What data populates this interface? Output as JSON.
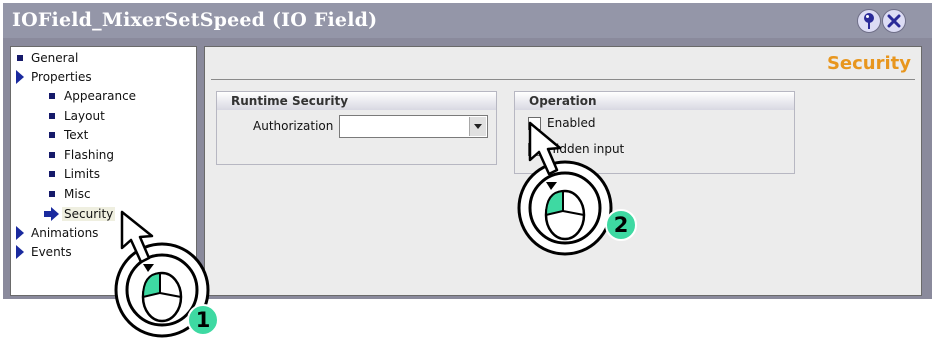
{
  "window": {
    "title": "IOField_MixerSetSpeed (IO Field)",
    "help_icon": "help-pin-icon",
    "close_icon": "close-icon"
  },
  "tree": {
    "items": [
      {
        "label": "General",
        "level": 0,
        "icon": "bullet"
      },
      {
        "label": "Properties",
        "level": 0,
        "icon": "expand-arrow"
      },
      {
        "label": "Appearance",
        "level": 1,
        "icon": "bullet"
      },
      {
        "label": "Layout",
        "level": 1,
        "icon": "bullet"
      },
      {
        "label": "Text",
        "level": 1,
        "icon": "bullet"
      },
      {
        "label": "Flashing",
        "level": 1,
        "icon": "bullet"
      },
      {
        "label": "Limits",
        "level": 1,
        "icon": "bullet"
      },
      {
        "label": "Misc",
        "level": 1,
        "icon": "bullet"
      },
      {
        "label": "Security",
        "level": 1,
        "icon": "selected-arrow",
        "selected": true
      },
      {
        "label": "Animations",
        "level": 0,
        "icon": "expand-arrow"
      },
      {
        "label": "Events",
        "level": 0,
        "icon": "expand-arrow"
      }
    ]
  },
  "panel": {
    "section_title": "Security",
    "runtime_security": {
      "title": "Runtime Security",
      "authorization_label": "Authorization",
      "authorization_value": ""
    },
    "operation": {
      "title": "Operation",
      "enabled_label": "Enabled",
      "enabled_checked": false,
      "hidden_input_label": "Hidden input"
    }
  },
  "callouts": [
    {
      "number": "1",
      "icon": "mouse-left-click-icon"
    },
    {
      "number": "2",
      "icon": "mouse-left-click-icon"
    }
  ],
  "colors": {
    "title_bar": "#9496a8",
    "section_title": "#e8961e",
    "badge": "#3ed9a2",
    "tree_icon": "#1a2a9e"
  }
}
